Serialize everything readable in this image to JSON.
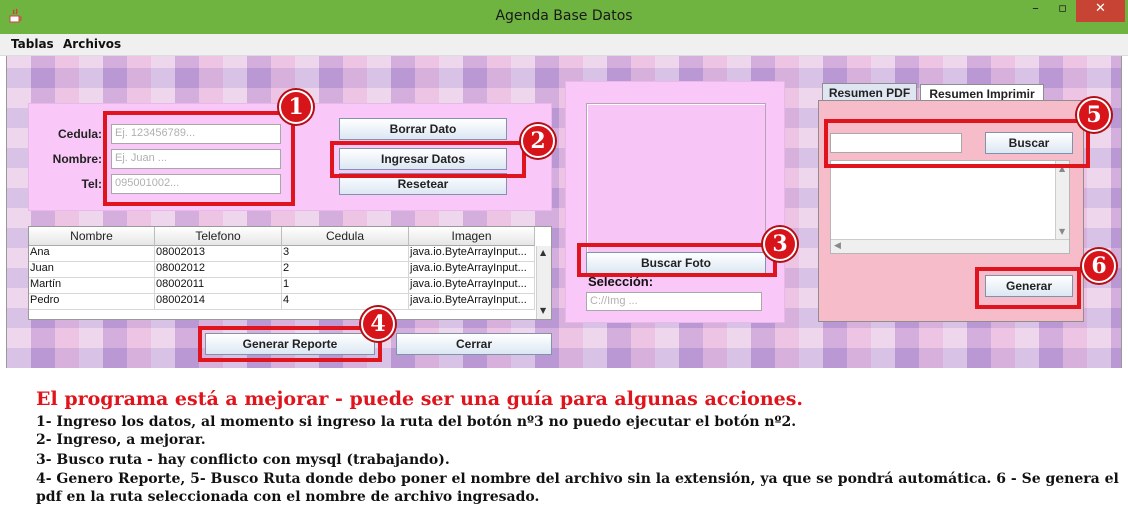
{
  "window": {
    "title": "Agenda Base Datos",
    "controls": {
      "minimize": "–",
      "maximize": "▫",
      "close": "✕"
    }
  },
  "menu": {
    "items": [
      "Tablas",
      "Archivos"
    ]
  },
  "form": {
    "cedula_label": "Cedula:",
    "nombre_label": "Nombre:",
    "tel_label": "Tel:",
    "cedula_placeholder": "Ej. 123456789...",
    "nombre_placeholder": "Ej. Juan ...",
    "tel_placeholder": "095001002...",
    "borrar_label": "Borrar Dato",
    "ingresar_label": "Ingresar Datos",
    "resetear_label": "Resetear"
  },
  "table": {
    "columns": [
      "Nombre",
      "Telefono",
      "Cedula",
      "Imagen"
    ],
    "rows": [
      [
        "Ana",
        "08002013",
        "3",
        "java.io.ByteArrayInput..."
      ],
      [
        "Juan",
        "08002012",
        "2",
        "java.io.ByteArrayInput..."
      ],
      [
        "Martín",
        "08002011",
        "1",
        "java.io.ByteArrayInput..."
      ],
      [
        "Pedro",
        "08002014",
        "4",
        "java.io.ByteArrayInput..."
      ]
    ]
  },
  "photo": {
    "buscar_foto_label": "Buscar Foto",
    "seleccion_label": "Selección:",
    "path_placeholder": "C://Img ..."
  },
  "report": {
    "tabs": [
      "Resumen PDF",
      "Resumen Imprimir"
    ],
    "search_value": "",
    "buscar_label": "Buscar",
    "generar_label": "Generar"
  },
  "bottom_buttons": {
    "generar_reporte_label": "Generar Reporte",
    "cerrar_label": "Cerrar"
  },
  "annotations": {
    "badges": [
      "1",
      "2",
      "3",
      "4",
      "5",
      "6"
    ],
    "color": "#e0141c"
  },
  "caption": {
    "title": "El programa está a mejorar - puede ser una guía para algunas acciones.",
    "lines": [
      "1- Ingreso los datos, al momento si ingreso la ruta del botón nº3 no puedo ejecutar el botón nº2.",
      "2- Ingreso, a mejorar.",
      "3- Busco ruta - hay conflicto con mysql (trabajando).",
      "4- Genero Reporte, 5- Busco Ruta donde debo poner el nombre del archivo sin la extensión, ya que se pondrá automática. 6 - Se genera el",
      "pdf en la ruta seleccionada con el nombre de archivo ingresado."
    ]
  }
}
